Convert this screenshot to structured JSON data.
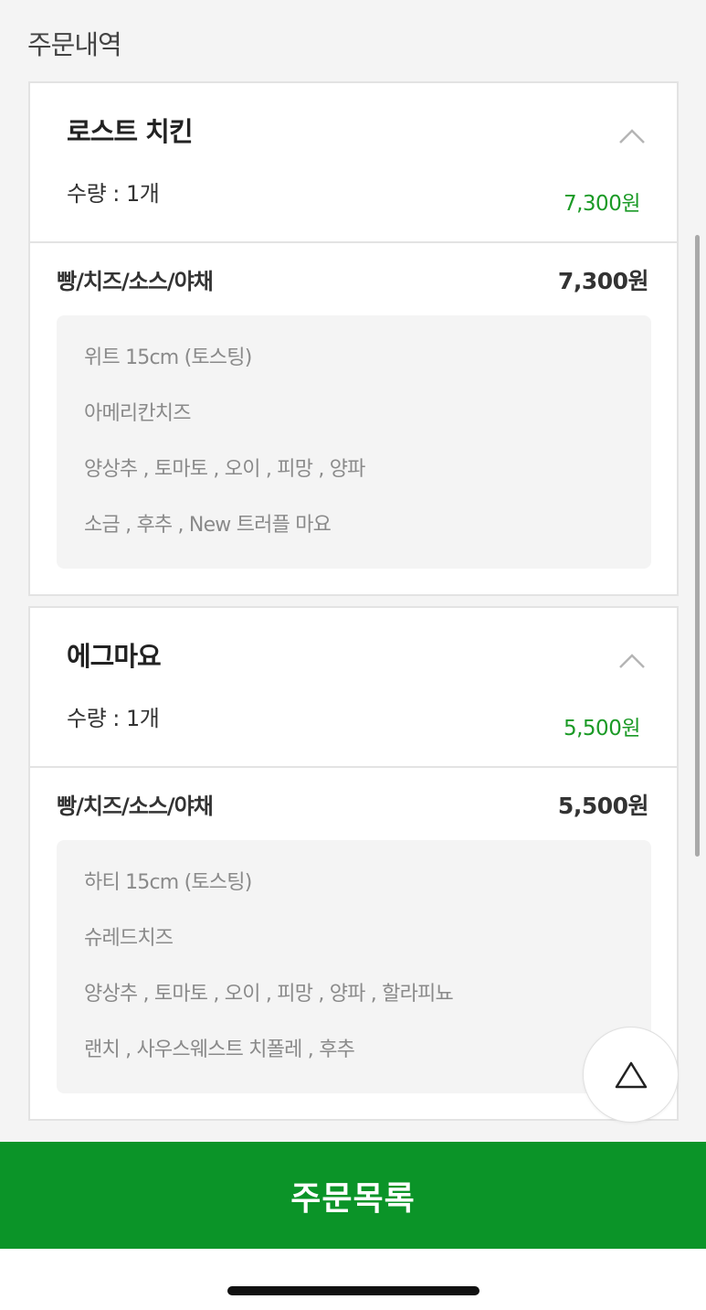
{
  "section_title": "주문내역",
  "orders": [
    {
      "name": "로스트 치킨",
      "quantity": "수량 : 1개",
      "price": "7,300원",
      "option_title": "빵/치즈/소스/야채",
      "option_price": "7,300원",
      "options": [
        "위트 15cm (토스팅)",
        "아메리칸치즈",
        "양상추 , 토마토 , 오이 , 피망 , 양파",
        "소금 , 후추 , New 트러플 마요"
      ]
    },
    {
      "name": "에그마요",
      "quantity": "수량 : 1개",
      "price": "5,500원",
      "option_title": "빵/치즈/소스/야채",
      "option_price": "5,500원",
      "options": [
        "하티 15cm (토스팅)",
        "슈레드치즈",
        "양상추 , 토마토 , 오이 , 피망 , 양파 , 할라피뇨",
        "랜치 , 사우스웨스트 치폴레 , 후추"
      ]
    }
  ],
  "bottom_button": "주문목록",
  "icons": {
    "collapse": "chevron-up-icon",
    "scroll_top": "triangle-up-icon"
  },
  "colors": {
    "accent": "#0b9428",
    "price": "#1b9a26"
  }
}
